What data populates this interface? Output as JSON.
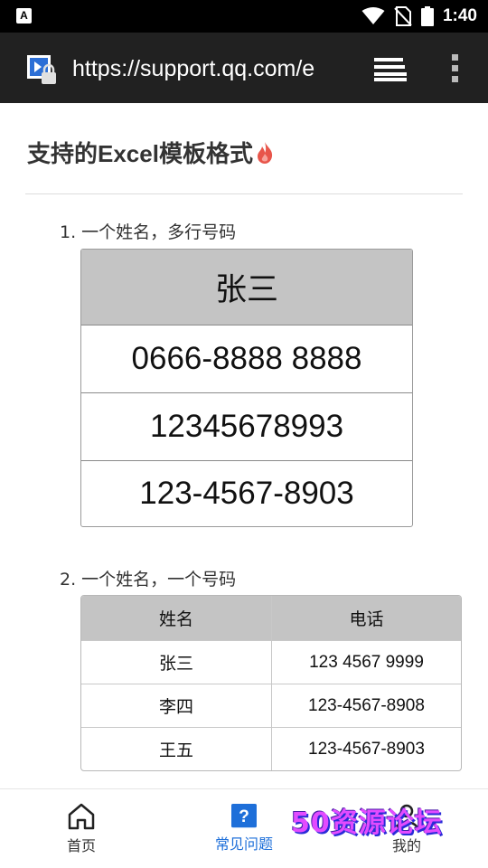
{
  "status_bar": {
    "time": "1:40",
    "notification_icon": "text-a-icon",
    "icons": [
      "wifi-icon",
      "no-sim-icon",
      "battery-icon"
    ]
  },
  "browser": {
    "url": "https://support.qq.com/e",
    "site_icon": "site-lock-icon",
    "tabs_icon": "tabs-icon",
    "menu_icon": "more-vert-icon"
  },
  "page": {
    "title": "支持的Excel模板格式",
    "title_icon": "flame-icon",
    "section1": {
      "label": "1. 一个姓名，多行号码",
      "header": "张三",
      "rows": [
        "0666-8888 8888",
        "12345678993",
        "123-4567-8903"
      ]
    },
    "section2": {
      "label": "2. 一个姓名，一个号码",
      "headers": [
        "姓名",
        "电话"
      ],
      "rows": [
        [
          "张三",
          "123 4567 9999"
        ],
        [
          "李四",
          "123-4567-8908"
        ],
        [
          "王五",
          "123-4567-8903"
        ]
      ]
    }
  },
  "bottom_nav": {
    "items": [
      {
        "label": "首页",
        "icon": "home-icon",
        "active": false
      },
      {
        "label": "常见问题",
        "icon": "question-icon",
        "active": true
      },
      {
        "label": "我的",
        "icon": "user-icon",
        "active": false
      }
    ],
    "active_color": "#1e6fd9"
  },
  "watermark": "50资源论坛"
}
